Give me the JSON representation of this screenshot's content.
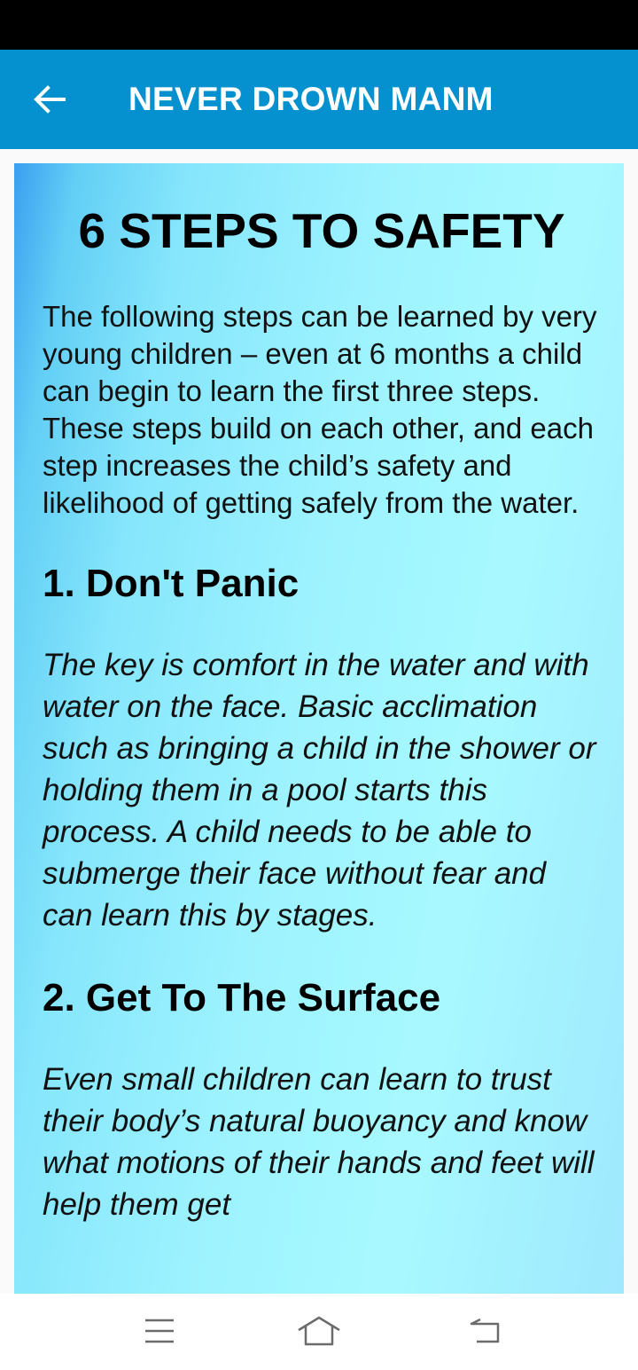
{
  "app_bar": {
    "title": "NEVER DROWN MANM",
    "back_icon": "arrow-left-icon",
    "color": "#0590cf"
  },
  "article": {
    "heading": "6 STEPS TO SAFETY",
    "intro": "The following steps can be learned by very young children – even at 6 months a child can begin to learn the first three steps. These steps build on each other, and each step increases the child’s safety and likelihood of getting safely from the water.",
    "steps": [
      {
        "title": "1. Don't Panic",
        "body": "The key is comfort in the water and with water on the face. Basic acclimation such as bringing a child in the shower or holding them in a pool starts this process. A child needs to be able to submerge their face without fear and can learn this by stages."
      },
      {
        "title": "2. Get To The Surface",
        "body": "Even small children can learn to trust their body’s natural buoyancy and know what motions of their hands and feet will help them get"
      }
    ]
  },
  "nav_bar": {
    "menu_icon": "menu-icon",
    "home_icon": "home-icon",
    "back_icon": "back-icon"
  }
}
